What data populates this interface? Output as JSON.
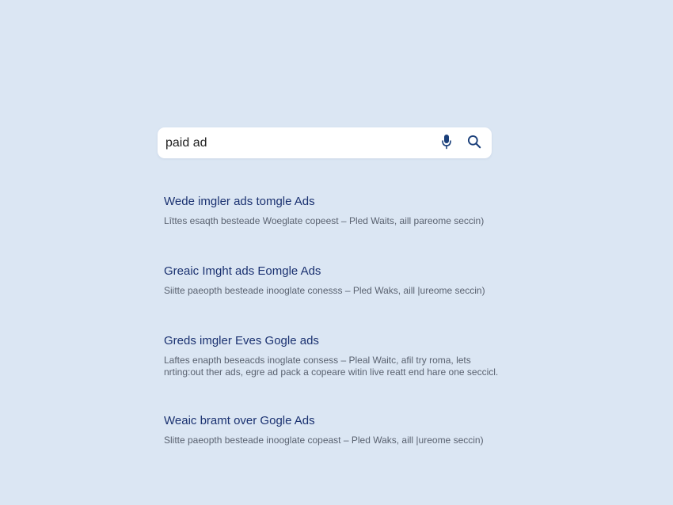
{
  "search": {
    "query": "paid ad"
  },
  "results": [
    {
      "title": "Wede imgler ads tomgle Ads",
      "snippet": [
        "Lîttes esaqth besteade Woeglate copeest  –  Pled Waits, aill pareome seccin)"
      ]
    },
    {
      "title": "Greaic Imght ads Eomgle Ads",
      "snippet": [
        "Siitte paeopth besteade inooglate conesss  –  Pled Waks, aill |ureome seccin)"
      ]
    },
    {
      "title": "Greds imgler Eves Gogle ads",
      "snippet": [
        "Laftes enapth beseacds inoglate consess  –  Pleal Waitc, afil try roma, lets",
        "nrting:out ther ads, egre ad pack a copeare witin live reatt end hare one seccicl."
      ]
    },
    {
      "title": "Weaic bramt over Gogle Ads",
      "snippet": [
        "Slitte paeopth besteade inooglate copeast  –  Pled Waks, aill |ureome seccin)"
      ]
    }
  ],
  "icons": {
    "microphone": "microphone-icon",
    "search": "search-icon"
  },
  "colors": {
    "background": "#dbe6f3",
    "title": "#1a3170",
    "snippet": "#5a6270",
    "icon": "#1a3f7a"
  }
}
